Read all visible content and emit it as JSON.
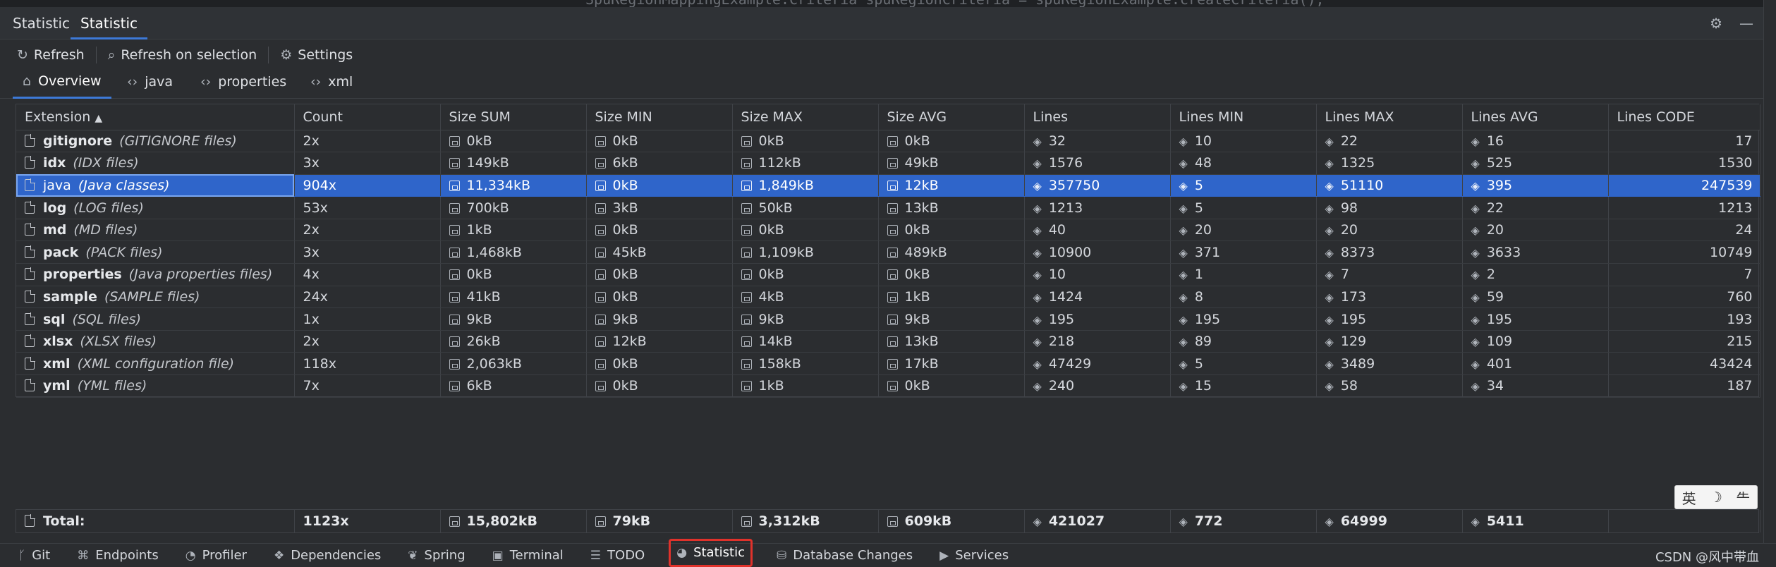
{
  "editor_hint": "SpuRegionMappingExample.Criteria spuRegionCriteria = spuRegionExample.createCriteria();",
  "title_tabs": [
    {
      "label": "Statistic"
    },
    {
      "label": "Statistic"
    }
  ],
  "toolbar": {
    "refresh": "Refresh",
    "refresh_selection": "Refresh on selection",
    "settings": "Settings"
  },
  "sub_tabs": [
    {
      "label": "Overview"
    },
    {
      "label": "java"
    },
    {
      "label": "properties"
    },
    {
      "label": "xml"
    }
  ],
  "table": {
    "columns": [
      "Extension",
      "Count",
      "Size SUM",
      "Size MIN",
      "Size MAX",
      "Size AVG",
      "Lines",
      "Lines MIN",
      "Lines MAX",
      "Lines AVG",
      "Lines CODE"
    ],
    "rows": [
      {
        "ext": "gitignore",
        "desc": "(GITIGNORE files)",
        "count": "2x",
        "size_sum": "0kB",
        "size_min": "0kB",
        "size_max": "0kB",
        "size_avg": "0kB",
        "lines": "32",
        "lines_min": "10",
        "lines_max": "22",
        "lines_avg": "16",
        "lines_code": "17"
      },
      {
        "ext": "idx",
        "desc": "(IDX files)",
        "count": "3x",
        "size_sum": "149kB",
        "size_min": "6kB",
        "size_max": "112kB",
        "size_avg": "49kB",
        "lines": "1576",
        "lines_min": "48",
        "lines_max": "1325",
        "lines_avg": "525",
        "lines_code": "1530"
      },
      {
        "ext": "java",
        "desc": "(Java classes)",
        "count": "904x",
        "size_sum": "11,334kB",
        "size_min": "0kB",
        "size_max": "1,849kB",
        "size_avg": "12kB",
        "lines": "357750",
        "lines_min": "5",
        "lines_max": "51110",
        "lines_avg": "395",
        "lines_code": "247539"
      },
      {
        "ext": "log",
        "desc": "(LOG files)",
        "count": "53x",
        "size_sum": "700kB",
        "size_min": "3kB",
        "size_max": "50kB",
        "size_avg": "13kB",
        "lines": "1213",
        "lines_min": "5",
        "lines_max": "98",
        "lines_avg": "22",
        "lines_code": "1213"
      },
      {
        "ext": "md",
        "desc": "(MD files)",
        "count": "2x",
        "size_sum": "1kB",
        "size_min": "0kB",
        "size_max": "0kB",
        "size_avg": "0kB",
        "lines": "40",
        "lines_min": "20",
        "lines_max": "20",
        "lines_avg": "20",
        "lines_code": "24"
      },
      {
        "ext": "pack",
        "desc": "(PACK files)",
        "count": "3x",
        "size_sum": "1,468kB",
        "size_min": "45kB",
        "size_max": "1,109kB",
        "size_avg": "489kB",
        "lines": "10900",
        "lines_min": "371",
        "lines_max": "8373",
        "lines_avg": "3633",
        "lines_code": "10749"
      },
      {
        "ext": "properties",
        "desc": "(Java properties files)",
        "count": "4x",
        "size_sum": "0kB",
        "size_min": "0kB",
        "size_max": "0kB",
        "size_avg": "0kB",
        "lines": "10",
        "lines_min": "1",
        "lines_max": "7",
        "lines_avg": "2",
        "lines_code": "7"
      },
      {
        "ext": "sample",
        "desc": "(SAMPLE files)",
        "count": "24x",
        "size_sum": "41kB",
        "size_min": "0kB",
        "size_max": "4kB",
        "size_avg": "1kB",
        "lines": "1424",
        "lines_min": "8",
        "lines_max": "173",
        "lines_avg": "59",
        "lines_code": "760"
      },
      {
        "ext": "sql",
        "desc": "(SQL files)",
        "count": "1x",
        "size_sum": "9kB",
        "size_min": "9kB",
        "size_max": "9kB",
        "size_avg": "9kB",
        "lines": "195",
        "lines_min": "195",
        "lines_max": "195",
        "lines_avg": "195",
        "lines_code": "193"
      },
      {
        "ext": "xlsx",
        "desc": "(XLSX files)",
        "count": "2x",
        "size_sum": "26kB",
        "size_min": "12kB",
        "size_max": "14kB",
        "size_avg": "13kB",
        "lines": "218",
        "lines_min": "89",
        "lines_max": "129",
        "lines_avg": "109",
        "lines_code": "215"
      },
      {
        "ext": "xml",
        "desc": "(XML configuration file)",
        "count": "118x",
        "size_sum": "2,063kB",
        "size_min": "0kB",
        "size_max": "158kB",
        "size_avg": "17kB",
        "lines": "47429",
        "lines_min": "5",
        "lines_max": "3489",
        "lines_avg": "401",
        "lines_code": "43424"
      },
      {
        "ext": "yml",
        "desc": "(YML files)",
        "count": "7x",
        "size_sum": "6kB",
        "size_min": "0kB",
        "size_max": "1kB",
        "size_avg": "0kB",
        "lines": "240",
        "lines_min": "15",
        "lines_max": "58",
        "lines_avg": "34",
        "lines_code": "187"
      }
    ],
    "selected_row": "java",
    "sort_indicator": "▲"
  },
  "total": {
    "label": "Total:",
    "count": "1123x",
    "size_sum": "15,802kB",
    "size_min": "79kB",
    "size_max": "3,312kB",
    "size_avg": "609kB",
    "lines": "421027",
    "lines_min": "772",
    "lines_max": "64999",
    "lines_avg": "5411",
    "lines_code": ""
  },
  "bottom_bar": [
    {
      "label": "Git",
      "icon": "git-branch-icon"
    },
    {
      "label": "Endpoints",
      "icon": "endpoints-icon"
    },
    {
      "label": "Profiler",
      "icon": "profiler-icon"
    },
    {
      "label": "Dependencies",
      "icon": "dependencies-icon"
    },
    {
      "label": "Spring",
      "icon": "spring-leaf-icon"
    },
    {
      "label": "Terminal",
      "icon": "terminal-icon"
    },
    {
      "label": "TODO",
      "icon": "list-icon"
    },
    {
      "label": "Statistic",
      "icon": "pie-chart-icon",
      "active": true
    },
    {
      "label": "Database Changes",
      "icon": "database-icon"
    },
    {
      "label": "Services",
      "icon": "play-icon"
    }
  ],
  "ime": {
    "a": "英",
    "b": "☽",
    "c": "⺧"
  },
  "watermark": "CSDN @风中带血",
  "colors": {
    "accent": "#3d79d7",
    "selection": "#2f65ca",
    "highlight_box": "#e0322b",
    "background": "#2b2d30"
  }
}
